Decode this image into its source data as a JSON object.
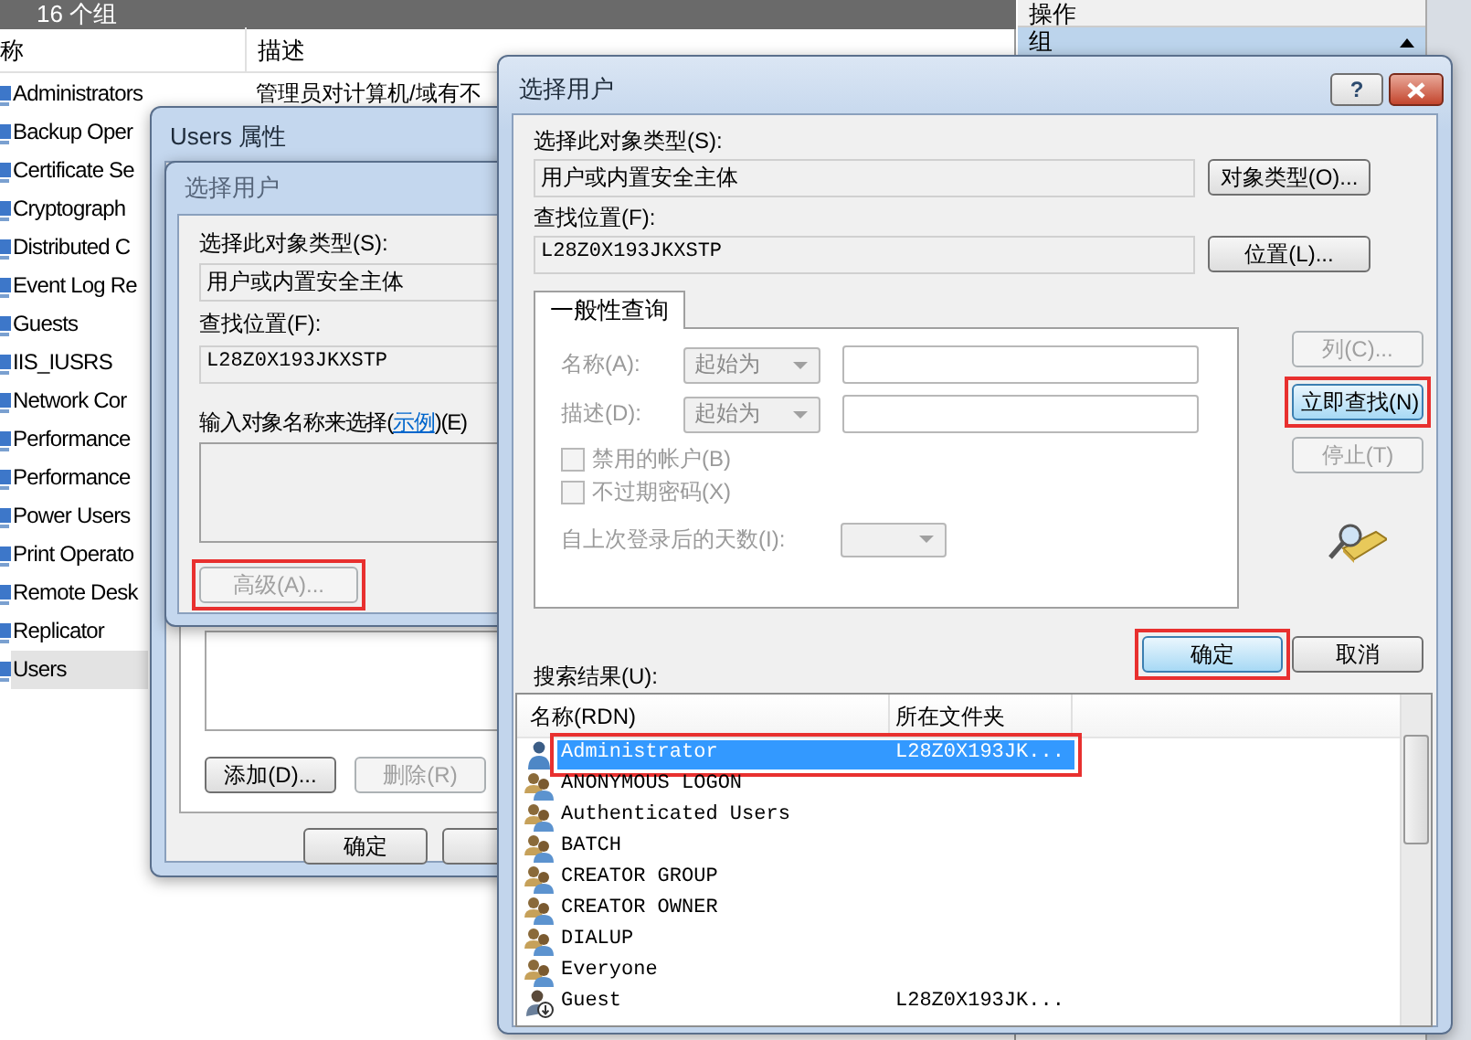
{
  "mmc": {
    "toolbar_text": "16 个组",
    "columns": [
      "称",
      "描述"
    ],
    "rows": [
      {
        "name": "Administrators",
        "description": "管理员对计算机/域有不",
        "selected": false
      },
      {
        "name": "Backup Oper",
        "selected": false
      },
      {
        "name": "Certificate Se",
        "selected": false
      },
      {
        "name": "Cryptograph",
        "selected": false
      },
      {
        "name": "Distributed C",
        "selected": false
      },
      {
        "name": "Event Log Re",
        "selected": false
      },
      {
        "name": "Guests",
        "selected": false
      },
      {
        "name": "IIS_IUSRS",
        "selected": false
      },
      {
        "name": "Network Cor",
        "selected": false
      },
      {
        "name": "Performance",
        "selected": false
      },
      {
        "name": "Performance",
        "selected": false
      },
      {
        "name": "Power Users",
        "selected": false
      },
      {
        "name": "Print Operato",
        "selected": false
      },
      {
        "name": "Remote Desk",
        "selected": false
      },
      {
        "name": "Replicator",
        "selected": false
      },
      {
        "name": "Users",
        "selected": true
      }
    ],
    "actions_header": "操作",
    "actions_group": "组"
  },
  "properties": {
    "title": "Users 属性",
    "buttons": [
      {
        "label": "添加(D)...",
        "disabled": false
      },
      {
        "label": "删除(R)",
        "disabled": true
      }
    ],
    "ok_button": "确定"
  },
  "back_picker": {
    "title": "选择用户",
    "type_label": "选择此对象类型(S):",
    "type_value": "用户或内置安全主体",
    "location_label": "查找位置(F):",
    "location_value": "L28Z0X193JKXSTP",
    "names_label": "输入对象名称来选择(",
    "example_link": "示例",
    "names_label_end": ")(E)",
    "advanced_button": {
      "label": "高级(A)...",
      "disabled": true,
      "highlighted": true
    }
  },
  "picker": {
    "title": "选择用户",
    "help_button": "?",
    "type_label": "选择此对象类型(S):",
    "type_value": "用户或内置安全主体",
    "object_types_button": "对象类型(O)...",
    "location_label": "查找位置(F):",
    "location_value": "L28Z0X193JKXSTP",
    "locations_button": "位置(L)...",
    "tabs": [
      {
        "label": "一般性查询",
        "selected": true
      }
    ],
    "query_disabled": true,
    "query_rows": [
      {
        "label": "名称(A):",
        "operator": "起始为"
      },
      {
        "label": "描述(D):",
        "operator": "起始为"
      }
    ],
    "checkboxes": [
      {
        "label": "禁用的帐户(B)",
        "checked": false
      },
      {
        "label": "不过期密码(X)",
        "checked": false
      }
    ],
    "days_label": "自上次登录后的天数(I):",
    "side_buttons": [
      {
        "label": "列(C)...",
        "disabled": true,
        "highlighted": false
      },
      {
        "label": "立即查找(N)",
        "disabled": false,
        "highlighted": true
      },
      {
        "label": "停止(T)",
        "disabled": true,
        "highlighted": false
      }
    ],
    "ok_button": {
      "label": "确定",
      "highlighted": true
    },
    "cancel_button": {
      "label": "取消"
    },
    "results_label": "搜索结果(U):",
    "results_columns": [
      "名称(RDN)",
      "所在文件夹"
    ],
    "results": [
      {
        "kind": "user",
        "name": "Administrator",
        "folder": "L28Z0X193JK...",
        "selected": true,
        "highlighted": true
      },
      {
        "kind": "group",
        "name": "ANONYMOUS LOGON",
        "selected": false,
        "highlighted": false
      },
      {
        "kind": "group",
        "name": "Authenticated Users",
        "selected": false,
        "highlighted": false
      },
      {
        "kind": "group",
        "name": "BATCH",
        "selected": false,
        "highlighted": false
      },
      {
        "kind": "group",
        "name": "CREATOR GROUP",
        "selected": false,
        "highlighted": false
      },
      {
        "kind": "group",
        "name": "CREATOR OWNER",
        "selected": false,
        "highlighted": false
      },
      {
        "kind": "group",
        "name": "DIALUP",
        "selected": false,
        "highlighted": false
      },
      {
        "kind": "group",
        "name": "Everyone",
        "selected": false,
        "highlighted": false
      },
      {
        "kind": "guest",
        "name": "Guest",
        "folder": "L28Z0X193JK...",
        "selected": false,
        "highlighted": false
      }
    ]
  }
}
